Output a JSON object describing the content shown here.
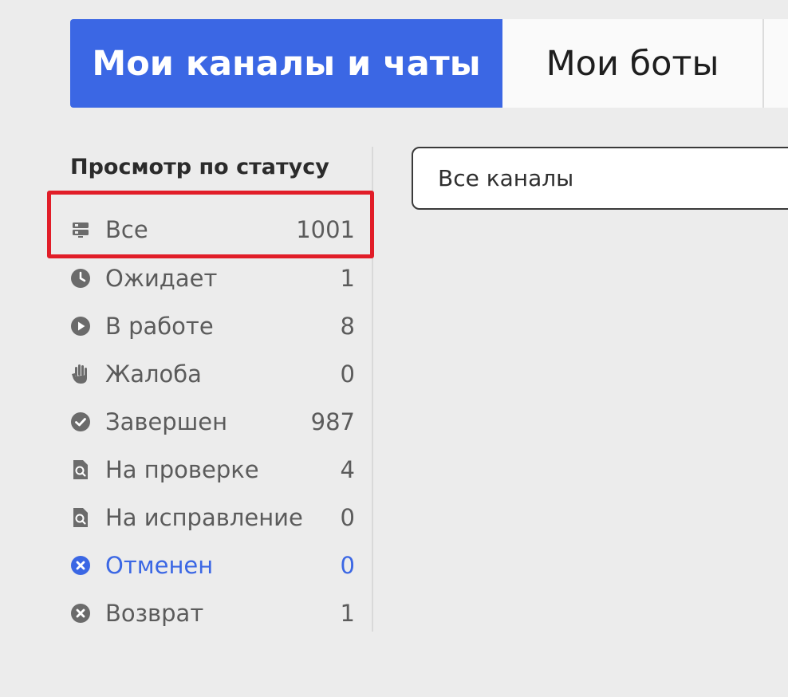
{
  "tabs": {
    "channels_chats": "Мои каналы и чаты",
    "bots": "Мои боты"
  },
  "sidebar": {
    "title": "Просмотр по статусу",
    "items": [
      {
        "label": "Все",
        "count": "1001",
        "icon": "monitor-icon"
      },
      {
        "label": "Ожидает",
        "count": "1",
        "icon": "clock-icon"
      },
      {
        "label": "В работе",
        "count": "8",
        "icon": "play-icon"
      },
      {
        "label": "Жалоба",
        "count": "0",
        "icon": "hand-icon"
      },
      {
        "label": "Завершен",
        "count": "987",
        "icon": "check-circle-icon"
      },
      {
        "label": "На проверке",
        "count": "4",
        "icon": "document-search-icon"
      },
      {
        "label": "На исправление",
        "count": "0",
        "icon": "document-search-icon"
      },
      {
        "label": "Отменен",
        "count": "0",
        "icon": "x-circle-icon"
      },
      {
        "label": "Возврат",
        "count": "1",
        "icon": "x-circle-icon"
      }
    ]
  },
  "filter": {
    "selected": "Все каналы"
  },
  "colors": {
    "accent": "#3b67e4",
    "highlight": "#e11d28",
    "icon": "#6b6b6b"
  }
}
